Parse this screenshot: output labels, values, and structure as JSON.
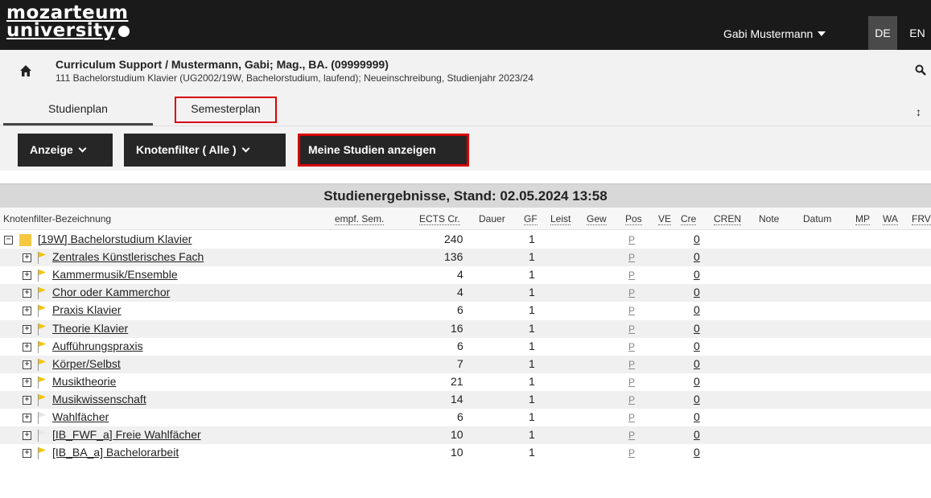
{
  "brand": {
    "line1": "mozarteum",
    "line2": "university"
  },
  "user": {
    "name": "Gabi Mustermann"
  },
  "languages": [
    "DE",
    "EN"
  ],
  "header": {
    "title": "Curriculum Support  / Mustermann, Gabi; Mag., BA. (09999999)",
    "subtitle": "111 Bachelorstudium Klavier (UG2002/19W, Bachelorstudium, laufend); Neueinschreibung, Studienjahr 2023/24"
  },
  "tabs": [
    "Studienplan",
    "Semesterplan"
  ],
  "toolbar": {
    "anzeige": "Anzeige",
    "knotenfilter": "Knotenfilter ( Alle )",
    "meine_studien": "Meine Studien anzeigen"
  },
  "caption": "Studienergebnisse, Stand: 02.05.2024 13:58",
  "columns": [
    "Knotenfilter-Bezeichnung",
    "empf. Sem.",
    "ECTS Cr.",
    "Dauer",
    "GF",
    "Leist",
    "Gew",
    "Pos",
    "VE",
    "Cre",
    "CREN",
    "Note",
    "Datum",
    "MP",
    "WA",
    "FRV"
  ],
  "rows": [
    {
      "name": "[19W] Bachelorstudium Klavier",
      "ects": "240",
      "gf": "1",
      "pos": "P",
      "cre": "0",
      "icon": "folder"
    },
    {
      "name": "Zentrales Künstlerisches Fach",
      "ects": "136",
      "gf": "1",
      "pos": "P",
      "cre": "0",
      "icon": "flag-yellow"
    },
    {
      "name": "Kammermusik/Ensemble",
      "ects": "4",
      "gf": "1",
      "pos": "P",
      "cre": "0",
      "icon": "flag-yellow"
    },
    {
      "name": "Chor oder Kammerchor",
      "ects": "4",
      "gf": "1",
      "pos": "P",
      "cre": "0",
      "icon": "flag-yellow"
    },
    {
      "name": "Praxis Klavier",
      "ects": "6",
      "gf": "1",
      "pos": "P",
      "cre": "0",
      "icon": "flag-yellow"
    },
    {
      "name": "Theorie Klavier",
      "ects": "16",
      "gf": "1",
      "pos": "P",
      "cre": "0",
      "icon": "flag-yellow"
    },
    {
      "name": "Aufführungspraxis",
      "ects": "6",
      "gf": "1",
      "pos": "P",
      "cre": "0",
      "icon": "flag-yellow"
    },
    {
      "name": "Körper/Selbst",
      "ects": "7",
      "gf": "1",
      "pos": "P",
      "cre": "0",
      "icon": "flag-yellow"
    },
    {
      "name": "Musiktheorie",
      "ects": "21",
      "gf": "1",
      "pos": "P",
      "cre": "0",
      "icon": "flag-yellow"
    },
    {
      "name": "Musikwissenschaft",
      "ects": "14",
      "gf": "1",
      "pos": "P",
      "cre": "0",
      "icon": "flag-yellow"
    },
    {
      "name": "Wahlfächer",
      "ects": "6",
      "gf": "1",
      "pos": "P",
      "cre": "0",
      "icon": "flag-white"
    },
    {
      "name": "[IB_FWF_a] Freie Wahlfächer",
      "ects": "10",
      "gf": "1",
      "pos": "P",
      "cre": "0",
      "icon": "flag-white"
    },
    {
      "name": "[IB_BA_a] Bachelorarbeit",
      "ects": "10",
      "gf": "1",
      "pos": "P",
      "cre": "0",
      "icon": "flag-yellow"
    }
  ],
  "colors": {
    "flag_yellow": "#f5c400",
    "flag_white": "#e6e6e6",
    "folder": "#f5c842",
    "highlight": "#d80000"
  }
}
